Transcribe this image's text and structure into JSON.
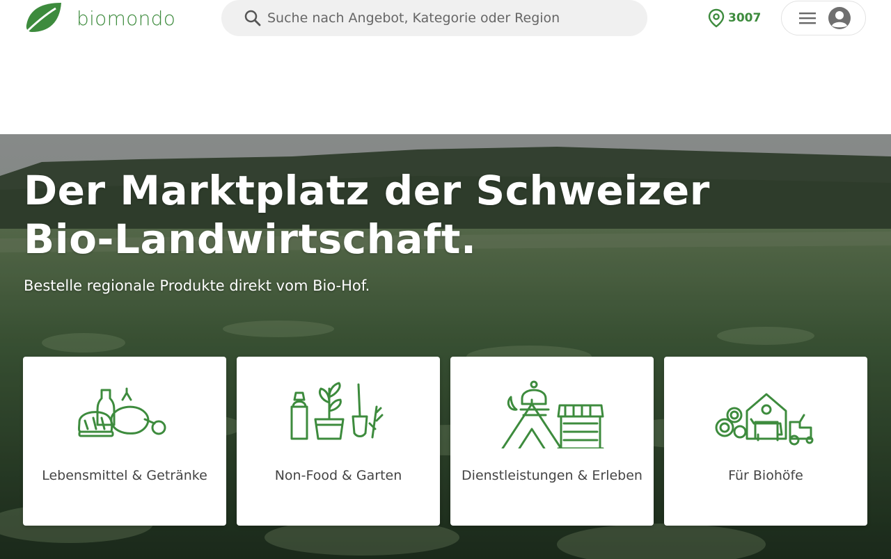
{
  "header": {
    "brand": "biomondo",
    "search_placeholder": "Suche nach Angebot, Kategorie oder Region",
    "location": "3007"
  },
  "hero": {
    "title": "Der Marktplatz der Schweizer Bio-Landwirtschaft.",
    "subtitle": "Bestelle regionale Produkte direkt vom Bio-Hof."
  },
  "categories": [
    {
      "label": "Lebensmittel & Getränke",
      "icon": "groceries-icon"
    },
    {
      "label": "Non-Food & Garten",
      "icon": "garden-icon"
    },
    {
      "label": "Dienstleistungen & Erleben",
      "icon": "services-icon"
    },
    {
      "label": "Für Biohöfe",
      "icon": "farm-icon"
    }
  ],
  "colors": {
    "brand_green": "#3d8b3d",
    "search_bg": "#f0f0f0",
    "card_bg": "#ffffff"
  }
}
